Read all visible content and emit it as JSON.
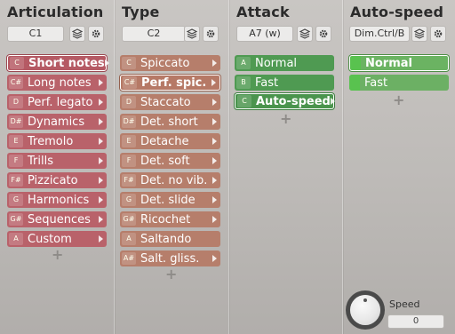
{
  "columns": [
    {
      "title": "Articulation",
      "key_field": "C1",
      "items": [
        {
          "key": "C",
          "label": "Short notes",
          "selected": true
        },
        {
          "key": "C#",
          "label": "Long notes"
        },
        {
          "key": "D",
          "label": "Perf. legato"
        },
        {
          "key": "D#",
          "label": "Dynamics"
        },
        {
          "key": "E",
          "label": "Tremolo"
        },
        {
          "key": "F",
          "label": "Trills"
        },
        {
          "key": "F#",
          "label": "Pizzicato"
        },
        {
          "key": "G",
          "label": "Harmonics"
        },
        {
          "key": "G#",
          "label": "Sequences"
        },
        {
          "key": "A",
          "label": "Custom"
        }
      ]
    },
    {
      "title": "Type",
      "key_field": "C2",
      "items": [
        {
          "key": "C",
          "label": "Spiccato"
        },
        {
          "key": "C#",
          "label": "Perf. spic.",
          "selected": true
        },
        {
          "key": "D",
          "label": "Staccato"
        },
        {
          "key": "D#",
          "label": "Det. short"
        },
        {
          "key": "E",
          "label": "Detache"
        },
        {
          "key": "F",
          "label": "Det. soft"
        },
        {
          "key": "F#",
          "label": "Det. no vib."
        },
        {
          "key": "G",
          "label": "Det. slide"
        },
        {
          "key": "G#",
          "label": "Ricochet"
        },
        {
          "key": "A",
          "label": "Saltando"
        },
        {
          "key": "A#",
          "label": "Salt. gliss."
        }
      ]
    },
    {
      "title": "Attack",
      "key_field": "A7 (w)",
      "items": [
        {
          "key": "A",
          "label": "Normal"
        },
        {
          "key": "B",
          "label": "Fast"
        },
        {
          "key": "C",
          "label": "Auto-speed",
          "selected": true
        }
      ]
    },
    {
      "title": "Auto-speed",
      "key_field": "Dim.Ctrl/B",
      "items": [
        {
          "label": "Normal",
          "selected": true
        },
        {
          "label": "Fast"
        }
      ]
    }
  ],
  "add_symbol": "+",
  "speed": {
    "label": "Speed",
    "value": "0"
  },
  "colors": {
    "articulation": "#b9626a",
    "type": "#b67e6b",
    "attack": "#4f9a52",
    "autospeed": "#6cb064"
  },
  "icons": {
    "layers": "layers-icon",
    "settings": "gear-icon",
    "arrow": "triangle-right-icon"
  }
}
